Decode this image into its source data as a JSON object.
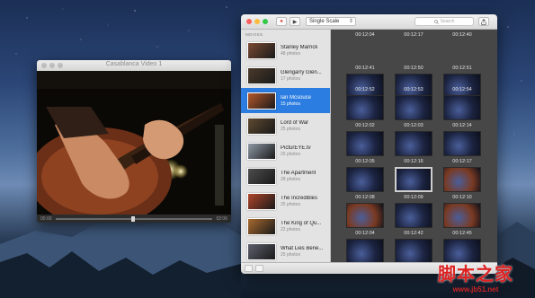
{
  "player": {
    "title": "Casablanca Video 1",
    "time_current": "00:00",
    "time_total": "02:06"
  },
  "main": {
    "select_value": "Single Scale",
    "search_placeholder": "Search",
    "sidebar_header": "MOVIES",
    "movies": [
      {
        "name": "Stanley Marrick",
        "count": "48 photos",
        "color": "#7a4a33"
      },
      {
        "name": "Glengarry Glen...",
        "count": "17 photos",
        "color": "#4a3a2a"
      },
      {
        "name": "Ian Mcsouce",
        "count": "15 photos",
        "color": "#b4572a",
        "selected": true
      },
      {
        "name": "Lord of War",
        "count": "25 photos",
        "color": "#5e4930"
      },
      {
        "name": "PicturEYE.tv",
        "count": "25 photos",
        "color": "#8f9aa6"
      },
      {
        "name": "The Apartment",
        "count": "28 photos",
        "color": "#4d4d4d"
      },
      {
        "name": "The Incredibles",
        "count": "25 photos",
        "color": "#b0452a"
      },
      {
        "name": "The King of Qu...",
        "count": "22 photos",
        "color": "#a86a2f"
      },
      {
        "name": "What Lies Bene...",
        "count": "25 photos",
        "color": "#5d5f6d"
      }
    ],
    "frames": [
      {
        "time": "00:12:04"
      },
      {
        "time": "00:12:17"
      },
      {
        "time": "00:12:40"
      },
      {
        "time": "00:12:41"
      },
      {
        "time": "00:12:50"
      },
      {
        "time": "00:12:51"
      },
      {
        "time": "00:12:52"
      },
      {
        "time": "00:12:53"
      },
      {
        "time": "00:12:54"
      },
      {
        "time": "00:12:02"
      },
      {
        "time": "00:12:03"
      },
      {
        "time": "00:12:14"
      },
      {
        "time": "00:12:05"
      },
      {
        "time": "00:12:16"
      },
      {
        "time": "00:12:17"
      },
      {
        "time": "00:12:08"
      },
      {
        "time": "00:12:09"
      },
      {
        "time": "00:12:10"
      },
      {
        "time": "00:12:04"
      },
      {
        "time": "00:12:42"
      },
      {
        "time": "00:12:45"
      }
    ]
  },
  "watermark": {
    "main": "脚本之家",
    "sub": "www.jb51.net"
  },
  "colors": {
    "selection": "#2b7de1",
    "frame_dark": "#1b2340",
    "frame_warm": "#7a3a22"
  }
}
